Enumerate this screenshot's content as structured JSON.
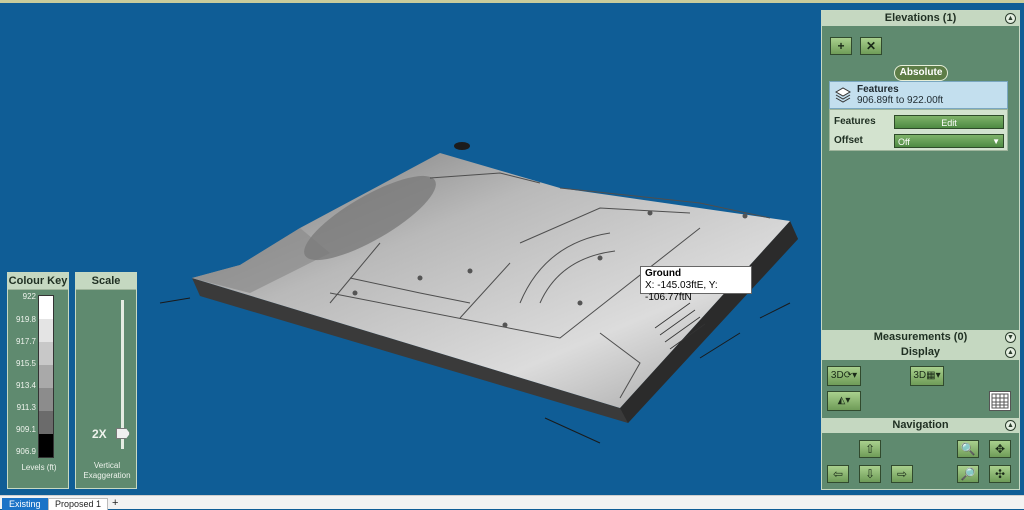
{
  "colors": {
    "viewport_bg": "#0f5d96",
    "panel_bg": "#5f8a6f",
    "panel_header": "#c5d8c1",
    "button_green": "#7fb36a",
    "selected_blue": "#c3dfee",
    "active_tab": "#1b73c7"
  },
  "tooltip": {
    "title": "Ground",
    "coords": "X: -145.03ftE, Y: -106.77ftN"
  },
  "colour_key": {
    "title": "Colour Key",
    "levels": [
      "922",
      "919.8",
      "917.7",
      "915.5",
      "913.4",
      "911.3",
      "909.1",
      "906.9"
    ],
    "footer": "Levels (ft)"
  },
  "scale": {
    "title": "Scale",
    "value": "2X",
    "footer_line1": "Vertical",
    "footer_line2": "Exaggeration",
    "level_fraction": 0.16
  },
  "elevations": {
    "header": "Elevations (1)",
    "add_icon": "plus-icon",
    "delete_icon": "delete-x-icon",
    "mode": "Absolute",
    "feature_name": "Features",
    "feature_range": "906.89ft to 922.00ft",
    "features_label": "Features",
    "edit_label": "Edit",
    "offset_label": "Offset",
    "offset_value": "Off"
  },
  "measurements": {
    "header": "Measurements (0)"
  },
  "display": {
    "header": "Display",
    "btn1_icon": "3d-rotate-icon",
    "btn2_icon": "3d-view-icon",
    "btn3_icon": "terrain-layer-icon",
    "grid_icon": "grid-icon"
  },
  "navigation": {
    "header": "Navigation",
    "up_icon": "arrow-up-icon",
    "down_icon": "arrow-down-icon",
    "left_icon": "arrow-left-icon",
    "right_icon": "arrow-right-icon",
    "zoom_in_icon": "zoom-in-icon",
    "zoom_out_icon": "zoom-out-icon",
    "pan_icon": "pan-move-icon",
    "fit_icon": "fit-extent-icon"
  },
  "tabs": [
    {
      "label": "Existing",
      "active": true
    },
    {
      "label": "Proposed 1",
      "active": false
    }
  ],
  "add_tab_label": "+"
}
